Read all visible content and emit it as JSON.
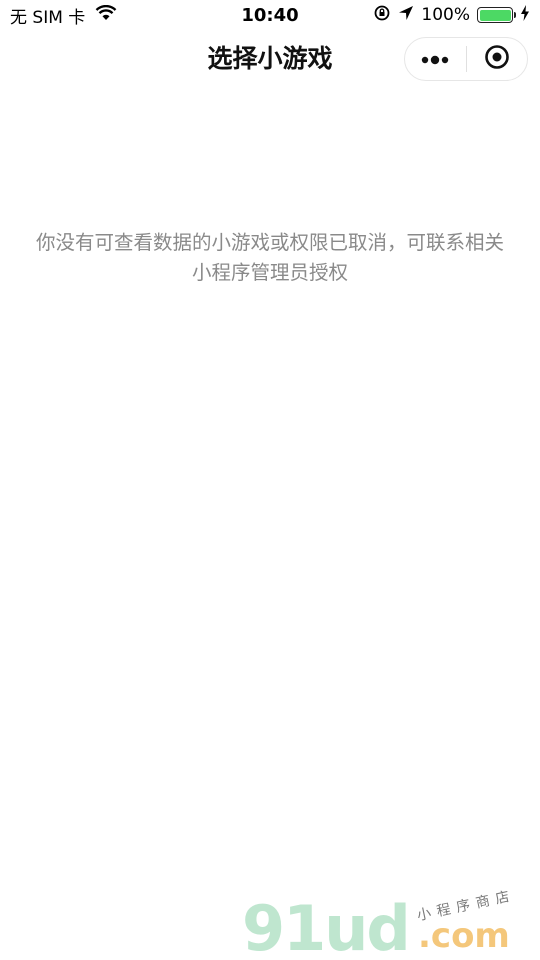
{
  "status_bar": {
    "carrier": "无 SIM 卡",
    "time": "10:40",
    "battery_percent": "100%",
    "battery_level": 1.0,
    "battery_color": "#4cd964"
  },
  "nav": {
    "title": "选择小游戏",
    "more_icon": "more-dots-icon",
    "close_icon": "target-circle-icon"
  },
  "content": {
    "message": "你没有可查看数据的小游戏或权限已取消，可联系相关小程序管理员授权"
  },
  "watermark": {
    "logo": "91ud",
    "subtitle": "小程序商店",
    "suffix": ".com"
  }
}
